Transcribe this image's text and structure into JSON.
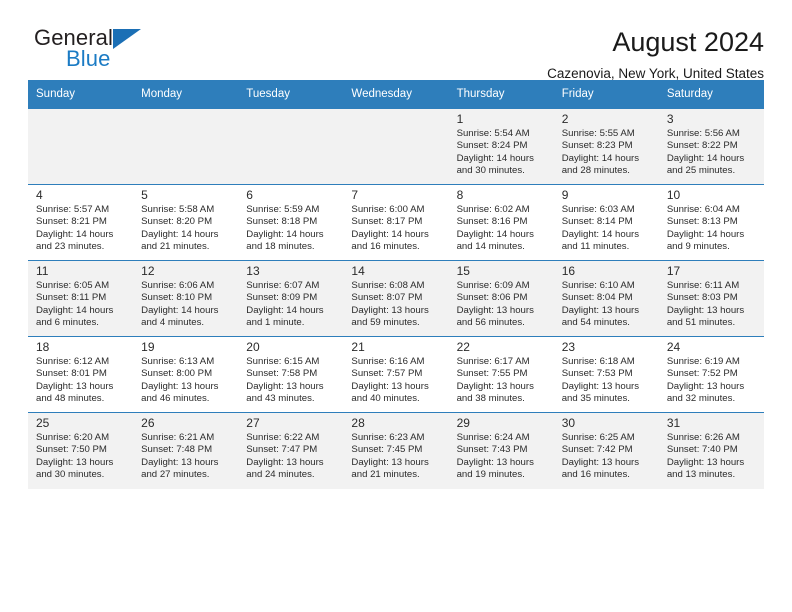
{
  "brand": {
    "name_part1": "General",
    "name_part2": "Blue",
    "flag_icon": "blue-triangle-flag-icon",
    "accent_color": "#1b7bc4"
  },
  "header": {
    "title": "August 2024",
    "subtitle": "Cazenovia, New York, United States"
  },
  "calendar": {
    "header_color": "#2e7ebb",
    "weekdays": [
      "Sunday",
      "Monday",
      "Tuesday",
      "Wednesday",
      "Thursday",
      "Friday",
      "Saturday"
    ],
    "weeks": [
      [
        {
          "day": "",
          "sunrise": "",
          "sunset": "",
          "daylight1": "",
          "daylight2": ""
        },
        {
          "day": "",
          "sunrise": "",
          "sunset": "",
          "daylight1": "",
          "daylight2": ""
        },
        {
          "day": "",
          "sunrise": "",
          "sunset": "",
          "daylight1": "",
          "daylight2": ""
        },
        {
          "day": "",
          "sunrise": "",
          "sunset": "",
          "daylight1": "",
          "daylight2": ""
        },
        {
          "day": "1",
          "sunrise": "Sunrise: 5:54 AM",
          "sunset": "Sunset: 8:24 PM",
          "daylight1": "Daylight: 14 hours",
          "daylight2": "and 30 minutes."
        },
        {
          "day": "2",
          "sunrise": "Sunrise: 5:55 AM",
          "sunset": "Sunset: 8:23 PM",
          "daylight1": "Daylight: 14 hours",
          "daylight2": "and 28 minutes."
        },
        {
          "day": "3",
          "sunrise": "Sunrise: 5:56 AM",
          "sunset": "Sunset: 8:22 PM",
          "daylight1": "Daylight: 14 hours",
          "daylight2": "and 25 minutes."
        }
      ],
      [
        {
          "day": "4",
          "sunrise": "Sunrise: 5:57 AM",
          "sunset": "Sunset: 8:21 PM",
          "daylight1": "Daylight: 14 hours",
          "daylight2": "and 23 minutes."
        },
        {
          "day": "5",
          "sunrise": "Sunrise: 5:58 AM",
          "sunset": "Sunset: 8:20 PM",
          "daylight1": "Daylight: 14 hours",
          "daylight2": "and 21 minutes."
        },
        {
          "day": "6",
          "sunrise": "Sunrise: 5:59 AM",
          "sunset": "Sunset: 8:18 PM",
          "daylight1": "Daylight: 14 hours",
          "daylight2": "and 18 minutes."
        },
        {
          "day": "7",
          "sunrise": "Sunrise: 6:00 AM",
          "sunset": "Sunset: 8:17 PM",
          "daylight1": "Daylight: 14 hours",
          "daylight2": "and 16 minutes."
        },
        {
          "day": "8",
          "sunrise": "Sunrise: 6:02 AM",
          "sunset": "Sunset: 8:16 PM",
          "daylight1": "Daylight: 14 hours",
          "daylight2": "and 14 minutes."
        },
        {
          "day": "9",
          "sunrise": "Sunrise: 6:03 AM",
          "sunset": "Sunset: 8:14 PM",
          "daylight1": "Daylight: 14 hours",
          "daylight2": "and 11 minutes."
        },
        {
          "day": "10",
          "sunrise": "Sunrise: 6:04 AM",
          "sunset": "Sunset: 8:13 PM",
          "daylight1": "Daylight: 14 hours",
          "daylight2": "and 9 minutes."
        }
      ],
      [
        {
          "day": "11",
          "sunrise": "Sunrise: 6:05 AM",
          "sunset": "Sunset: 8:11 PM",
          "daylight1": "Daylight: 14 hours",
          "daylight2": "and 6 minutes."
        },
        {
          "day": "12",
          "sunrise": "Sunrise: 6:06 AM",
          "sunset": "Sunset: 8:10 PM",
          "daylight1": "Daylight: 14 hours",
          "daylight2": "and 4 minutes."
        },
        {
          "day": "13",
          "sunrise": "Sunrise: 6:07 AM",
          "sunset": "Sunset: 8:09 PM",
          "daylight1": "Daylight: 14 hours",
          "daylight2": "and 1 minute."
        },
        {
          "day": "14",
          "sunrise": "Sunrise: 6:08 AM",
          "sunset": "Sunset: 8:07 PM",
          "daylight1": "Daylight: 13 hours",
          "daylight2": "and 59 minutes."
        },
        {
          "day": "15",
          "sunrise": "Sunrise: 6:09 AM",
          "sunset": "Sunset: 8:06 PM",
          "daylight1": "Daylight: 13 hours",
          "daylight2": "and 56 minutes."
        },
        {
          "day": "16",
          "sunrise": "Sunrise: 6:10 AM",
          "sunset": "Sunset: 8:04 PM",
          "daylight1": "Daylight: 13 hours",
          "daylight2": "and 54 minutes."
        },
        {
          "day": "17",
          "sunrise": "Sunrise: 6:11 AM",
          "sunset": "Sunset: 8:03 PM",
          "daylight1": "Daylight: 13 hours",
          "daylight2": "and 51 minutes."
        }
      ],
      [
        {
          "day": "18",
          "sunrise": "Sunrise: 6:12 AM",
          "sunset": "Sunset: 8:01 PM",
          "daylight1": "Daylight: 13 hours",
          "daylight2": "and 48 minutes."
        },
        {
          "day": "19",
          "sunrise": "Sunrise: 6:13 AM",
          "sunset": "Sunset: 8:00 PM",
          "daylight1": "Daylight: 13 hours",
          "daylight2": "and 46 minutes."
        },
        {
          "day": "20",
          "sunrise": "Sunrise: 6:15 AM",
          "sunset": "Sunset: 7:58 PM",
          "daylight1": "Daylight: 13 hours",
          "daylight2": "and 43 minutes."
        },
        {
          "day": "21",
          "sunrise": "Sunrise: 6:16 AM",
          "sunset": "Sunset: 7:57 PM",
          "daylight1": "Daylight: 13 hours",
          "daylight2": "and 40 minutes."
        },
        {
          "day": "22",
          "sunrise": "Sunrise: 6:17 AM",
          "sunset": "Sunset: 7:55 PM",
          "daylight1": "Daylight: 13 hours",
          "daylight2": "and 38 minutes."
        },
        {
          "day": "23",
          "sunrise": "Sunrise: 6:18 AM",
          "sunset": "Sunset: 7:53 PM",
          "daylight1": "Daylight: 13 hours",
          "daylight2": "and 35 minutes."
        },
        {
          "day": "24",
          "sunrise": "Sunrise: 6:19 AM",
          "sunset": "Sunset: 7:52 PM",
          "daylight1": "Daylight: 13 hours",
          "daylight2": "and 32 minutes."
        }
      ],
      [
        {
          "day": "25",
          "sunrise": "Sunrise: 6:20 AM",
          "sunset": "Sunset: 7:50 PM",
          "daylight1": "Daylight: 13 hours",
          "daylight2": "and 30 minutes."
        },
        {
          "day": "26",
          "sunrise": "Sunrise: 6:21 AM",
          "sunset": "Sunset: 7:48 PM",
          "daylight1": "Daylight: 13 hours",
          "daylight2": "and 27 minutes."
        },
        {
          "day": "27",
          "sunrise": "Sunrise: 6:22 AM",
          "sunset": "Sunset: 7:47 PM",
          "daylight1": "Daylight: 13 hours",
          "daylight2": "and 24 minutes."
        },
        {
          "day": "28",
          "sunrise": "Sunrise: 6:23 AM",
          "sunset": "Sunset: 7:45 PM",
          "daylight1": "Daylight: 13 hours",
          "daylight2": "and 21 minutes."
        },
        {
          "day": "29",
          "sunrise": "Sunrise: 6:24 AM",
          "sunset": "Sunset: 7:43 PM",
          "daylight1": "Daylight: 13 hours",
          "daylight2": "and 19 minutes."
        },
        {
          "day": "30",
          "sunrise": "Sunrise: 6:25 AM",
          "sunset": "Sunset: 7:42 PM",
          "daylight1": "Daylight: 13 hours",
          "daylight2": "and 16 minutes."
        },
        {
          "day": "31",
          "sunrise": "Sunrise: 6:26 AM",
          "sunset": "Sunset: 7:40 PM",
          "daylight1": "Daylight: 13 hours",
          "daylight2": "and 13 minutes."
        }
      ]
    ]
  }
}
